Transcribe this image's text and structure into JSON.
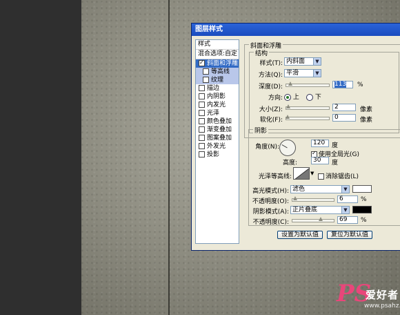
{
  "dialog": {
    "title": "图层样式"
  },
  "list": {
    "header": "样式",
    "blend": "混合选项:自定",
    "items": [
      {
        "label": "斜面和浮雕",
        "checked": true
      },
      {
        "label": "等高线",
        "checked": false
      },
      {
        "label": "纹理",
        "checked": false
      },
      {
        "label": "描边",
        "checked": false
      },
      {
        "label": "内阴影",
        "checked": false
      },
      {
        "label": "内发光",
        "checked": false
      },
      {
        "label": "光泽",
        "checked": false
      },
      {
        "label": "颜色叠加",
        "checked": false
      },
      {
        "label": "渐变叠加",
        "checked": false
      },
      {
        "label": "图案叠加",
        "checked": false
      },
      {
        "label": "外发光",
        "checked": false
      },
      {
        "label": "投影",
        "checked": false
      }
    ]
  },
  "bevel": {
    "section": "斜面和浮雕",
    "structure": "结构",
    "style_label": "样式(T):",
    "style_value": "内斜面",
    "technique_label": "方法(Q):",
    "technique_value": "平滑",
    "depth_label": "深度(D):",
    "depth_value": "113",
    "depth_unit": "%",
    "direction_label": "方向:",
    "dir_up": "上",
    "dir_down": "下",
    "direction_selected": "上",
    "size_label": "大小(Z):",
    "size_value": "2",
    "size_unit": "像素",
    "soften_label": "软化(F):",
    "soften_value": "0",
    "soften_unit": "像素"
  },
  "shading": {
    "section": "阴影",
    "angle_label": "角度(N):",
    "angle_value": "120",
    "angle_unit": "度",
    "global_light_label": "使用全局光(G)",
    "global_light": true,
    "altitude_label": "高度:",
    "altitude_value": "30",
    "altitude_unit": "度",
    "gloss_label": "光泽等高线:",
    "antialias_label": "消除锯齿(L)",
    "antialias": false,
    "highlight_mode_label": "高光模式(H):",
    "highlight_mode": "滤色",
    "highlight_color": "#ffffff",
    "highlight_opacity_label": "不透明度(O):",
    "highlight_opacity": "6",
    "highlight_opacity_unit": "%",
    "shadow_mode_label": "阴影模式(A):",
    "shadow_mode": "正片叠底",
    "shadow_color": "#000000",
    "shadow_opacity_label": "不透明度(C):",
    "shadow_opacity": "69",
    "shadow_opacity_unit": "%"
  },
  "buttons": {
    "make_default": "设置为默认值",
    "reset_default": "复位为默认值"
  },
  "watermark": {
    "ps": "PS",
    "cn": "爱好者",
    "url": "www.psahz.com"
  }
}
